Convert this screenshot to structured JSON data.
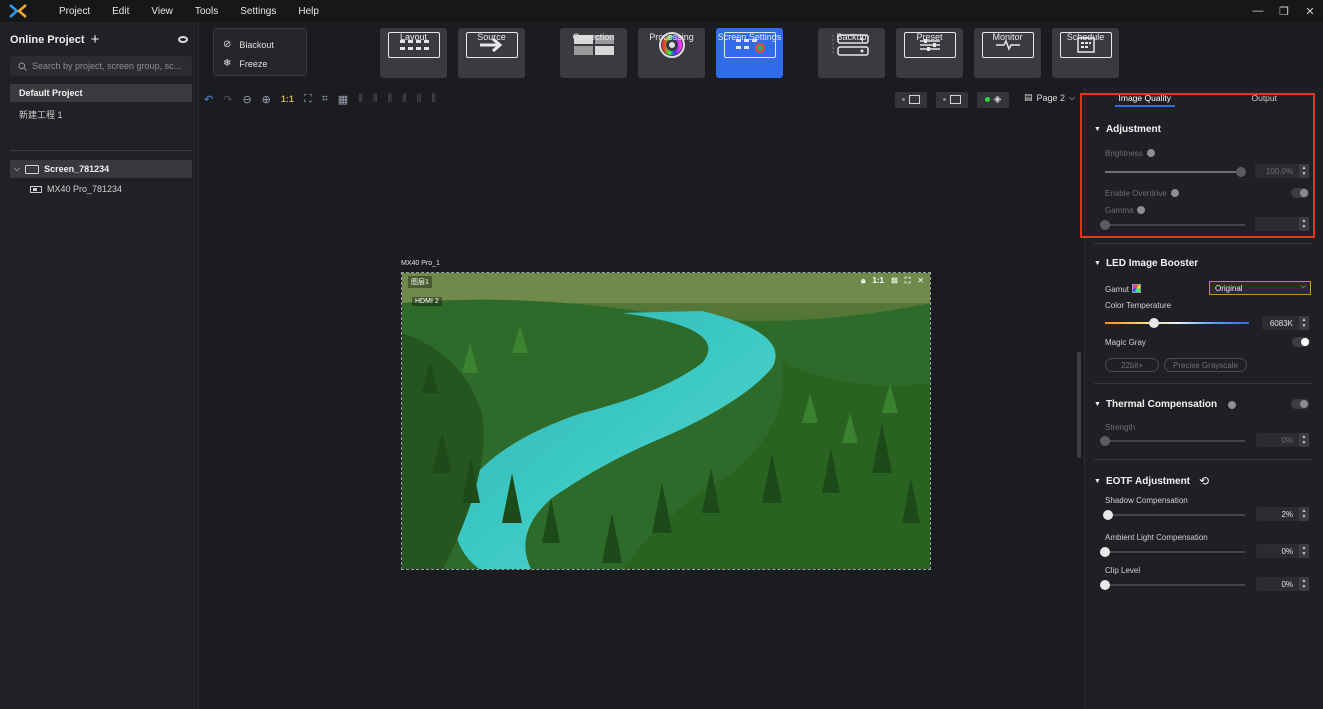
{
  "menu": [
    "Project",
    "Edit",
    "View",
    "Tools",
    "Settings",
    "Help"
  ],
  "window_controls": [
    "minimize-icon",
    "restore-icon",
    "close-icon"
  ],
  "left_panel": {
    "title": "Online Project",
    "search_placeholder": "Search by project, screen group, sc...",
    "default_project": "Default Project",
    "new_project": "新建工程 1",
    "screen": "Screen_781234",
    "device": "MX40 Pro_781234"
  },
  "toolbar": {
    "blackout": "Blackout",
    "freeze": "Freeze",
    "buttons": [
      "Layout",
      "Source",
      "Correction",
      "Processing",
      "Screen Settings",
      "Backup",
      "Preset",
      "Monitor",
      "Schedule"
    ],
    "active": "Screen Settings",
    "zoom_label": "1:1",
    "page": "Page 2"
  },
  "canvas": {
    "device_label": "MX40 Pro_1",
    "layer_label": "图层1",
    "source_label": "HDMI 2",
    "frame_ratio": "1:1"
  },
  "right_panel": {
    "tabs": [
      "Image Quality",
      "Output"
    ],
    "active_tab": "Image Quality",
    "adjustment": {
      "title": "Adjustment",
      "brightness_label": "Brightness",
      "brightness_value": "100.0%",
      "brightness_level": 1.0,
      "overdrive_label": "Enable Overdrive",
      "overdrive_on": false,
      "gamma_label": "Gamma",
      "gamma_value": "",
      "gamma_level": 0.0
    },
    "led_booster": {
      "title": "LED Image Booster",
      "gamut_label": "Gamut",
      "gamut_value": "Original",
      "color_temp_label": "Color Temperature",
      "color_temp_value": "6083K",
      "color_temp_level": 0.34,
      "magic_gray_label": "Magic Gray",
      "magic_gray_on": true,
      "chips": [
        "22bit+",
        "Precise Grayscale"
      ]
    },
    "thermal": {
      "title": "Thermal Compensation",
      "on": false,
      "strength_label": "Strength",
      "strength_value": "0%",
      "strength_level": 0.0
    },
    "eotf": {
      "title": "EOTF Adjustment",
      "shadow_label": "Shadow Compensation",
      "shadow_value": "2%",
      "shadow_level": 0.02,
      "ambient_label": "Ambient Light Compensation",
      "ambient_value": "0%",
      "ambient_level": 0.0,
      "clip_label": "Clip Level",
      "clip_value": "0%",
      "clip_level": 0.0
    }
  },
  "colors": {
    "accent_blue": "#2f6bea",
    "highlight_red": "#e8341c",
    "select_border": "#d38b2c",
    "status_green": "#2bd14b"
  }
}
